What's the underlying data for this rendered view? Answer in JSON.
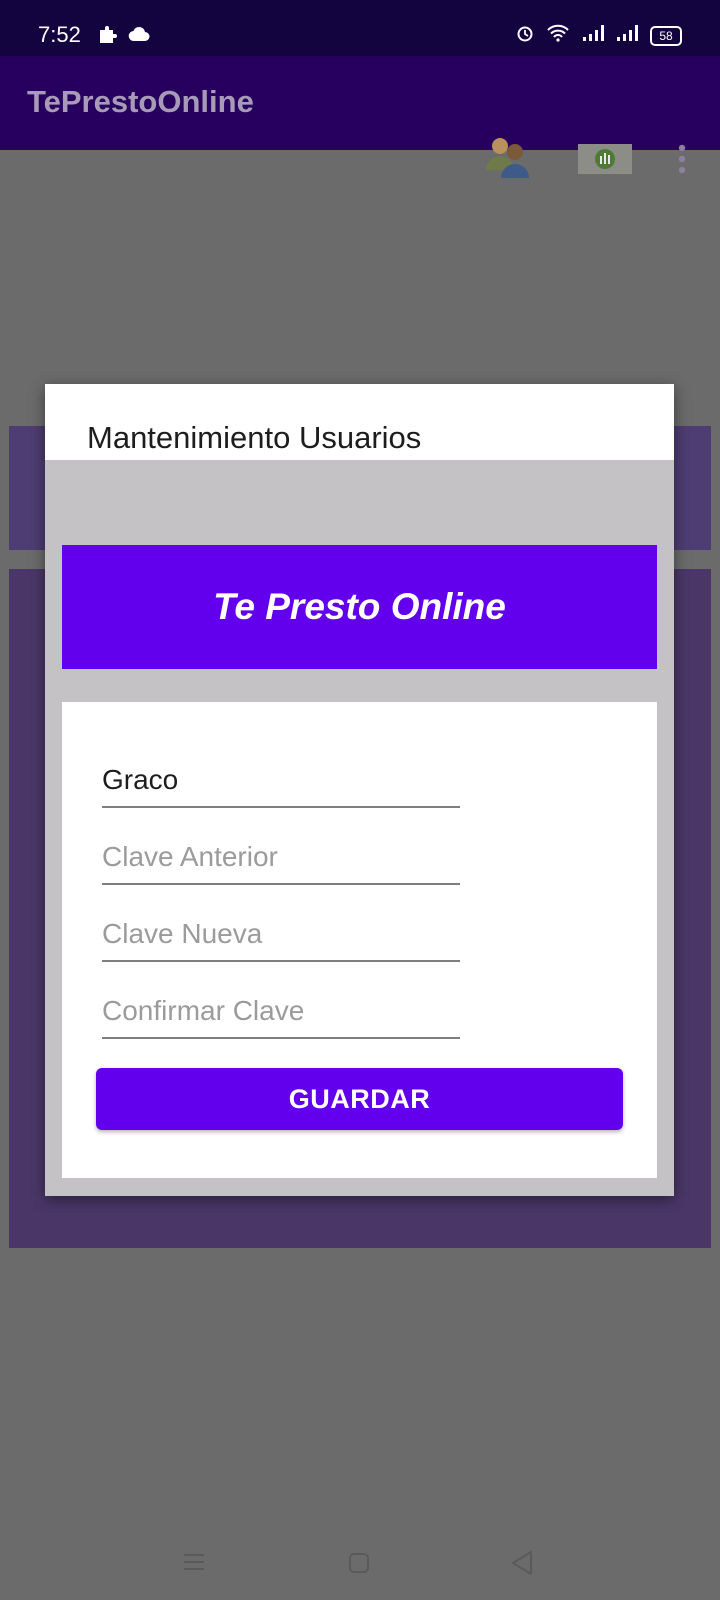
{
  "status_bar": {
    "time": "7:52",
    "battery": "58",
    "left_icons": [
      "puzzle-icon",
      "cloud-icon"
    ],
    "right_icons": [
      "alarm-icon",
      "wifi-icon",
      "signal-icon",
      "signal-icon",
      "battery-icon"
    ]
  },
  "app_bar": {
    "title": "TePrestoOnline",
    "actions": [
      "users-icon",
      "report-icon",
      "more-vert-icon"
    ]
  },
  "dialog": {
    "title": "Mantenimiento Usuarios",
    "banner": "Te Presto Online",
    "fields": {
      "user": {
        "value": "Graco"
      },
      "old_password": {
        "placeholder": "Clave Anterior"
      },
      "new_password": {
        "placeholder": "Clave Nueva"
      },
      "confirm_password": {
        "placeholder": "Confirmar Clave"
      }
    },
    "save_label": "GUARDAR"
  },
  "nav_bar": {
    "icons": [
      "menu-icon",
      "home-icon",
      "back-icon"
    ]
  },
  "colors": {
    "primary": "#6200ee",
    "app_bar": "#27005f",
    "status_bar": "#13033e",
    "scrim": "#6b6b6b"
  }
}
